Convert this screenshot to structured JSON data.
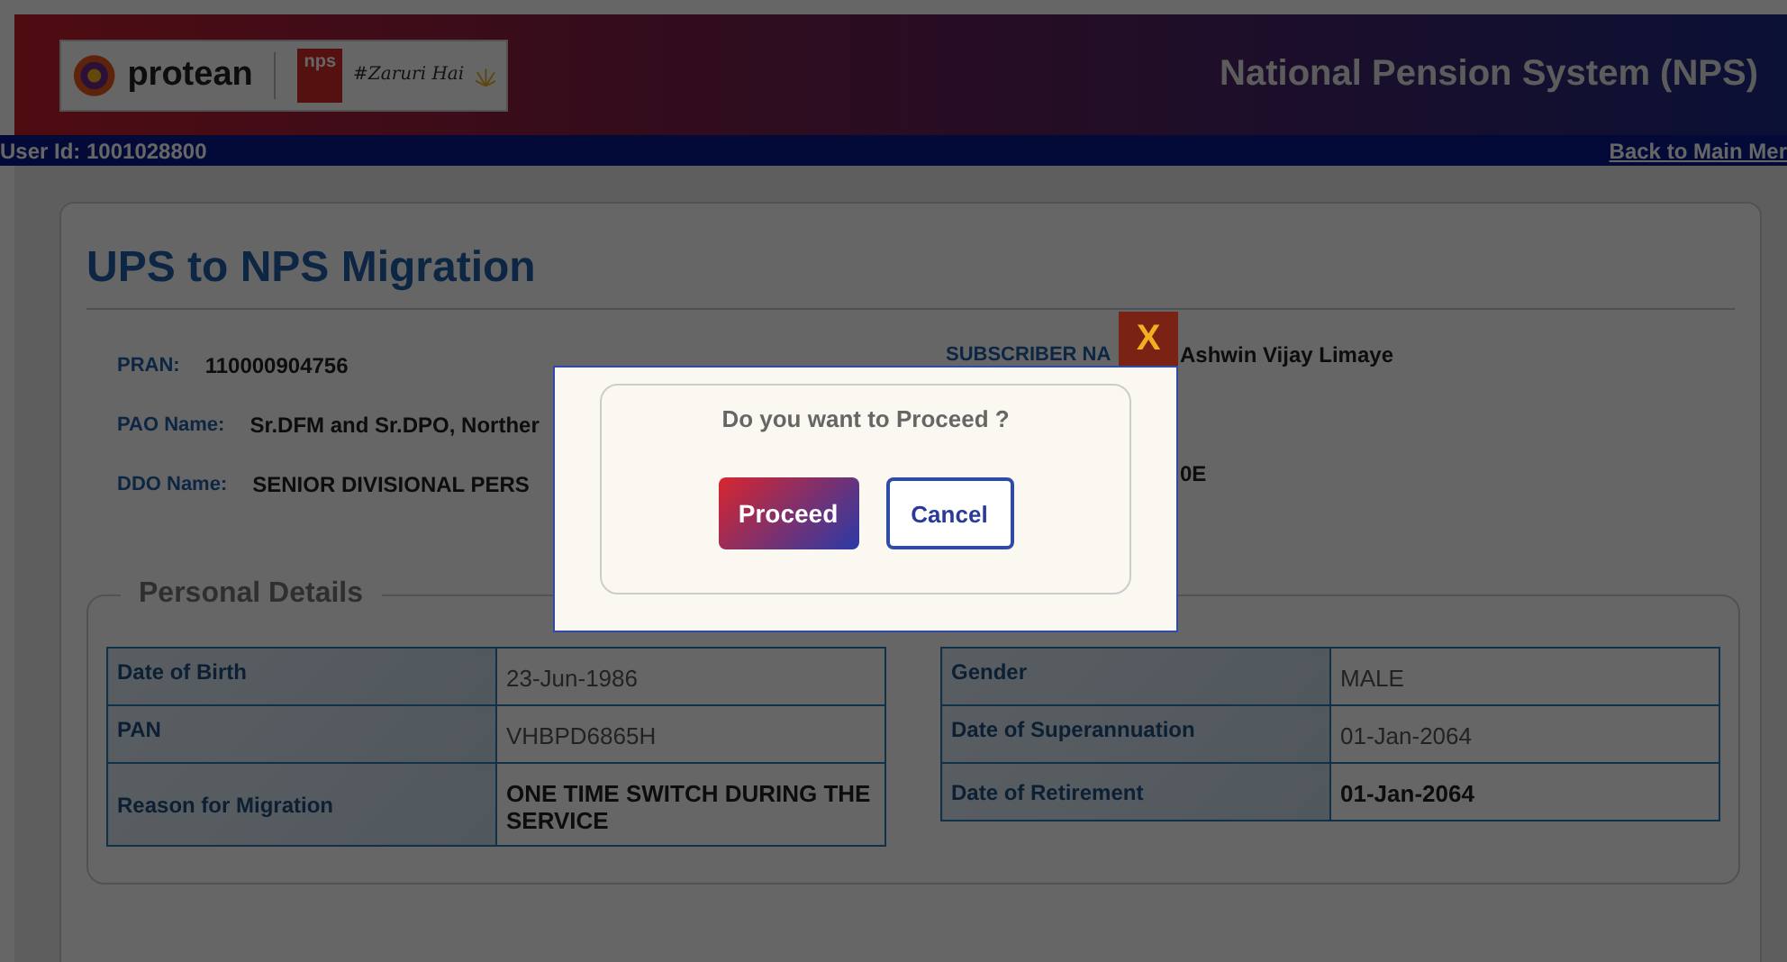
{
  "header": {
    "brand": "protean",
    "tag_logo": "nps",
    "tagline": "#Zaruri Hai",
    "title": "National Pension System (NPS)"
  },
  "user_bar": {
    "user_id": "User Id: 1001028800",
    "back_link": "Back to Main Mer"
  },
  "page": {
    "title": "UPS to NPS Migration",
    "info_left": [
      {
        "label": "PRAN:",
        "value": "110000904756"
      },
      {
        "label": "PAO Name:",
        "value": "Sr.DFM and Sr.DPO, Norther"
      },
      {
        "label": "DDO Name:",
        "value": "SENIOR DIVISIONAL PERS"
      }
    ],
    "info_right": [
      {
        "label": "SUBSCRIBER NA",
        "value": "Ashwin Vijay Limaye"
      },
      {
        "value": "0E"
      }
    ]
  },
  "personal_details": {
    "legend": "Personal Details",
    "left_table": [
      {
        "label": "Date of Birth",
        "value": "23-Jun-1986",
        "bold": false
      },
      {
        "label": "PAN",
        "value": "VHBPD6865H",
        "bold": false
      },
      {
        "label": "Reason for Migration",
        "value": "ONE TIME SWITCH DURING THE SERVICE",
        "bold": true
      }
    ],
    "right_table": [
      {
        "label": "Gender",
        "value": "MALE",
        "bold": false
      },
      {
        "label": "Date of Superannuation",
        "value": "01-Jan-2064",
        "bold": false
      },
      {
        "label": "Date of Retirement",
        "value": "01-Jan-2064",
        "bold": true
      }
    ]
  },
  "dialog": {
    "close": "X",
    "message": "Do you want to Proceed ?",
    "buttons": [
      "Proceed",
      "Cancel"
    ]
  }
}
